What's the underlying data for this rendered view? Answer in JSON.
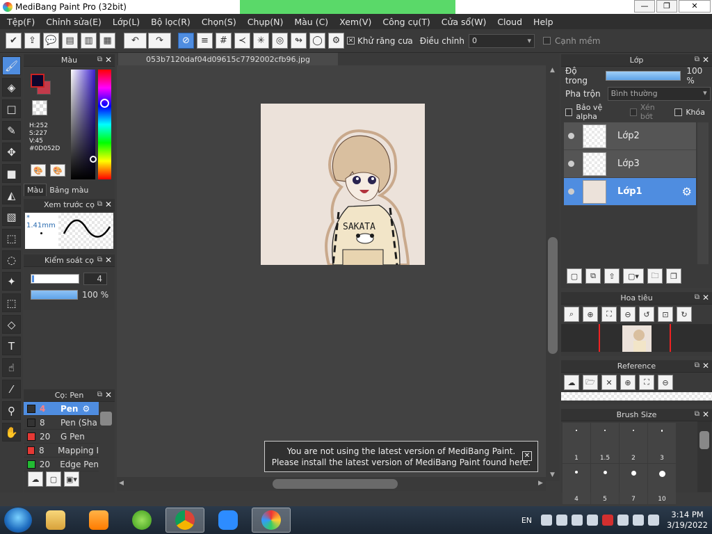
{
  "window": {
    "title": "MediBang Paint Pro (32bit)",
    "btn_min": "—",
    "btn_max": "❐",
    "btn_close": "✕"
  },
  "menu": [
    "Tệp(F)",
    "Chỉnh sửa(E)",
    "Lớp(L)",
    "Bộ lọc(R)",
    "Chọn(S)",
    "Chụp(N)",
    "Màu (C)",
    "Xem(V)",
    "Công cụ(T)",
    "Cửa sổ(W)",
    "Cloud",
    "Help"
  ],
  "toolbar": {
    "antialias_label": "Khử răng cưa",
    "adjust_label": "Điều chỉnh",
    "adjust_value": "0",
    "soft_edge_label": "Cạnh mềm"
  },
  "color_panel": {
    "title": "Màu",
    "hsv_h": "H:252",
    "hsv_s": "S:227",
    "hsv_v": "V:45",
    "hex": "#0D052D",
    "tab_color": "Màu",
    "tab_palette": "Bảng màu",
    "color_hex": "#0d052d"
  },
  "preview_panel": {
    "title": "Xem trước cọ",
    "size": "* 1.41mm"
  },
  "control_panel": {
    "title": "Kiểm soát cọ",
    "size_value": "4",
    "opacity_value": "100 %"
  },
  "brush_panel": {
    "title": "Cọ: Pen",
    "items": [
      {
        "size": "4",
        "name": "Pen",
        "color": "#333333",
        "active": true
      },
      {
        "size": "8",
        "name": "Pen (Sha",
        "color": "#333333",
        "active": false
      },
      {
        "size": "20",
        "name": "G Pen",
        "color": "#e53935",
        "active": false
      },
      {
        "size": "8",
        "name": "Mapping I",
        "color": "#e53935",
        "active": false
      },
      {
        "size": "20",
        "name": "Edge Pen",
        "color": "#22bb33",
        "active": false
      }
    ]
  },
  "canvas": {
    "tab_name": "053b7120daf04d09615c7792002cfb96.jpg",
    "artwork_text": "SAKATA"
  },
  "notification": {
    "line1": "You are not using the latest version of MediBang Paint.",
    "line2": "Please install the latest version of MediBang Paint found here."
  },
  "layer_panel": {
    "title": "Lớp",
    "opacity_label": "Độ trong",
    "opacity_value": "100 %",
    "blend_label": "Pha trộn",
    "blend_value": "Bình thường",
    "protect_alpha": "Bảo vệ alpha",
    "clip": "Xén bớt",
    "lock": "Khóa",
    "layers": [
      "Lớp2",
      "Lớp3",
      "Lớp1"
    ]
  },
  "navigator_panel": {
    "title": "Hoa tiêu"
  },
  "reference_panel": {
    "title": "Reference"
  },
  "brush_size_panel": {
    "title": "Brush Size",
    "sizes": [
      "1",
      "1.5",
      "2",
      "3",
      "4",
      "5",
      "7",
      "10"
    ]
  },
  "taskbar": {
    "lang": "EN",
    "time": "3:14 PM",
    "date": "3/19/2022"
  }
}
